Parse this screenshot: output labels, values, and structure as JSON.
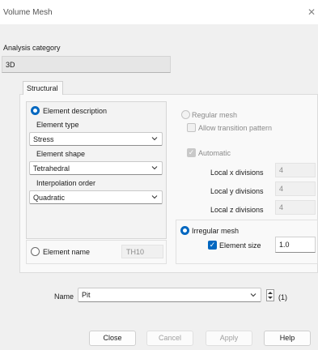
{
  "window": {
    "title": "Volume Mesh",
    "close_glyph": "✕"
  },
  "analysis": {
    "label": "Analysis category",
    "value": "3D"
  },
  "tabs": [
    {
      "label": "Structural"
    }
  ],
  "element_description": {
    "label": "Element description",
    "element_type": {
      "label": "Element type",
      "value": "Stress"
    },
    "element_shape": {
      "label": "Element shape",
      "value": "Tetrahedral"
    },
    "interpolation_order": {
      "label": "Interpolation order",
      "value": "Quadratic"
    }
  },
  "element_name": {
    "label": "Element name",
    "value": "TH10"
  },
  "regular_mesh": {
    "label": "Regular mesh",
    "allow_transition": "Allow transition pattern",
    "automatic": "Automatic",
    "local_x": {
      "label": "Local x divisions",
      "value": "4"
    },
    "local_y": {
      "label": "Local y divisions",
      "value": "4"
    },
    "local_z": {
      "label": "Local z divisions",
      "value": "4"
    }
  },
  "irregular_mesh": {
    "label": "Irregular mesh",
    "element_size": {
      "label": "Element size",
      "value": "1.0"
    }
  },
  "name": {
    "label": "Name",
    "value": "Pit",
    "counter": "(1)"
  },
  "buttons": {
    "close": "Close",
    "cancel": "Cancel",
    "apply": "Apply",
    "help": "Help"
  },
  "icons": {
    "chevron": "chevron-down-icon",
    "spin": "spin-updown-icon"
  },
  "colors": {
    "accent": "#0067c0",
    "background": "#f0f0f0"
  }
}
